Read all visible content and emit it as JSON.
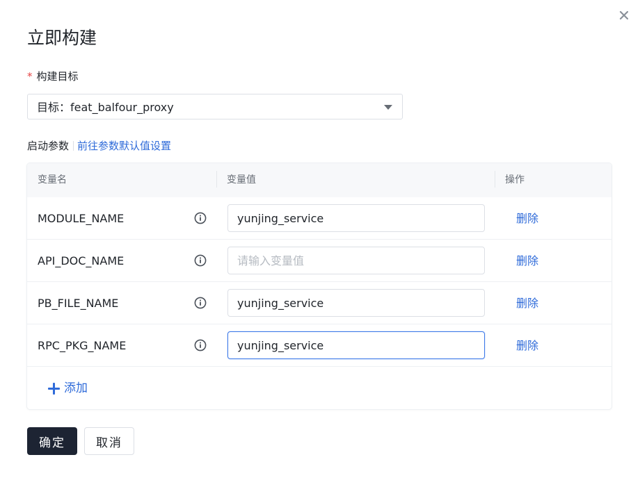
{
  "dialog": {
    "title": "立即构建",
    "close_icon": "close-icon"
  },
  "target": {
    "required_mark": "*",
    "label": "构建目标",
    "prefix": "目标：",
    "value": "feat_balfour_proxy"
  },
  "params": {
    "label": "启动参数",
    "defaults_link": "前往参数默认值设置"
  },
  "table": {
    "headers": [
      "变量名",
      "变量值",
      "操作"
    ],
    "rows": [
      {
        "name": "MODULE_NAME",
        "value": "yunjing_service",
        "placeholder": "请输入变量值",
        "action": "删除"
      },
      {
        "name": "API_DOC_NAME",
        "value": "",
        "placeholder": "请输入变量值",
        "action": "删除"
      },
      {
        "name": "PB_FILE_NAME",
        "value": "yunjing_service",
        "placeholder": "请输入变量值",
        "action": "删除"
      },
      {
        "name": "RPC_PKG_NAME",
        "value": "yunjing_service",
        "placeholder": "请输入变量值",
        "action": "删除"
      }
    ],
    "add_label": "添加"
  },
  "footer": {
    "confirm": "确定",
    "cancel": "取消"
  },
  "colors": {
    "accent": "#2f6bd9",
    "primary_button": "#1d2433",
    "required": "#e54545"
  }
}
